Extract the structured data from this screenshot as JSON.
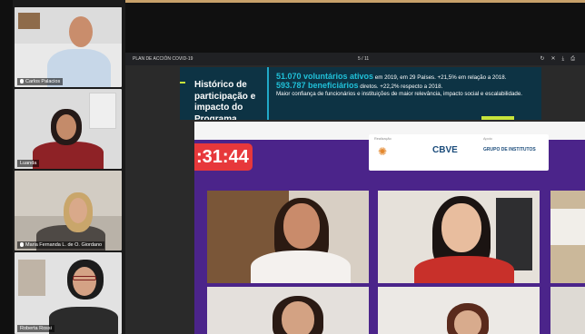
{
  "participants": [
    {
      "name": "Carlos Palacios"
    },
    {
      "name": "Luanda"
    },
    {
      "name": "Maria Fernanda L. de O. Giordano"
    },
    {
      "name": "Roberta Rossi"
    }
  ],
  "shared_window": {
    "title": "PLAN DE ACCIÓN COVID-19",
    "page_indicator": "5 / 11",
    "icons": [
      "refresh-icon",
      "close-icon",
      "download-icon",
      "print-icon"
    ]
  },
  "slide": {
    "heading": "Histórico de participação e impacto do Programa",
    "stat1_value": "51.070 voluntários ativos",
    "stat1_rest": " em 2019, em 29 Países. +21,5% em relação a 2018.",
    "stat2_value": "593.787 beneficiários",
    "stat2_rest": " diretos. +22,2% respecto a 2018.",
    "line3": "Maior confiança de funcionários e instituições de maior relevância, impacto social e escalabilidade."
  },
  "meeting": {
    "timer": ":31:44",
    "sponsor_labels": [
      "Realização",
      "Apoio"
    ],
    "sponsor_logos": [
      "CBVE",
      "GRUPO DE INSTITUTOS"
    ]
  },
  "colors": {
    "accent_purple": "#4b248a",
    "timer_red": "#e7383b",
    "slide_navy": "#0d3344",
    "slide_cyan": "#20c0d8",
    "slide_lime": "#c7e43b"
  }
}
